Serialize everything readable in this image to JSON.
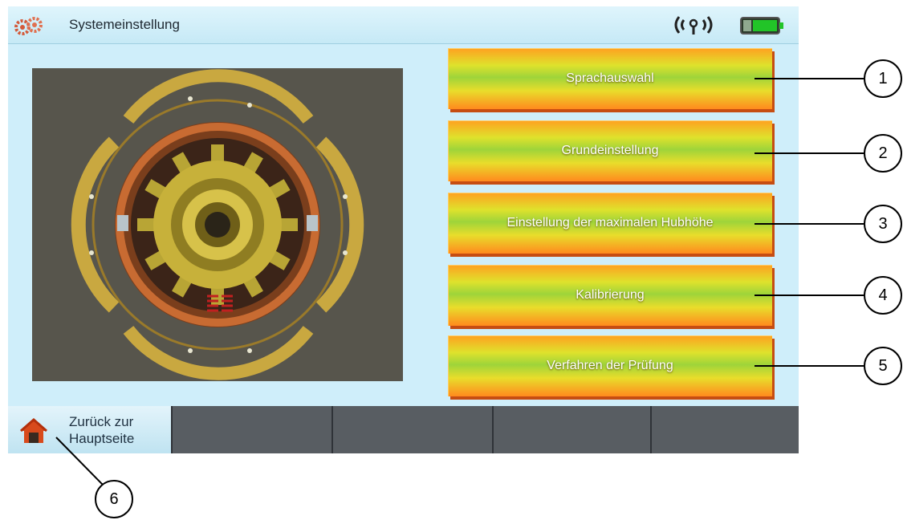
{
  "title": "Systemeinstellung",
  "menu": [
    {
      "label": "Sprachauswahl"
    },
    {
      "label": "Grundeinstellung"
    },
    {
      "label": "Einstellung der maximalen Hubhöhe"
    },
    {
      "label": "Kalibrierung"
    },
    {
      "label": "Verfahren der Prüfung"
    }
  ],
  "bottom": {
    "home_label_line1": "Zurück zur",
    "home_label_line2": "Hauptseite"
  },
  "callouts": [
    "1",
    "2",
    "3",
    "4",
    "5",
    "6"
  ],
  "icons": {
    "app": "gears-icon",
    "wifi": "wifi-signal-icon",
    "battery": "battery-icon",
    "home": "house-icon"
  },
  "colors": {
    "screen_bg": "#cfeefa",
    "button_orange": "#ff8a1e",
    "button_green": "#9ed43a",
    "bottom_bar": "#585d62"
  }
}
